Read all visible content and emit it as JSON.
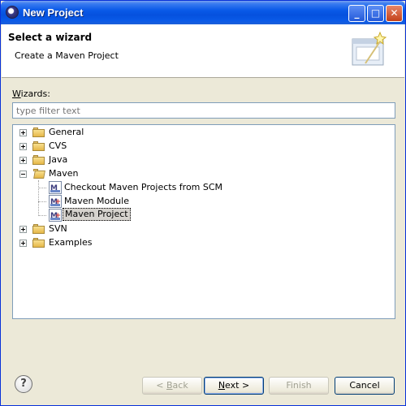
{
  "window": {
    "title": "New Project"
  },
  "header": {
    "title": "Select a wizard",
    "subtitle": "Create a Maven Project"
  },
  "wizards_label": {
    "accel": "W",
    "rest": "izards:"
  },
  "filter": {
    "placeholder": "type filter text",
    "value": ""
  },
  "tree": {
    "items": [
      {
        "label": "General",
        "expanded": false
      },
      {
        "label": "CVS",
        "expanded": false
      },
      {
        "label": "Java",
        "expanded": false
      },
      {
        "label": "Maven",
        "expanded": true,
        "children": [
          {
            "label": "Checkout Maven Projects from SCM"
          },
          {
            "label": "Maven Module"
          },
          {
            "label": "Maven Project",
            "selected": true
          }
        ]
      },
      {
        "label": "SVN",
        "expanded": false
      },
      {
        "label": "Examples",
        "expanded": false
      }
    ]
  },
  "buttons": {
    "back": {
      "accel": "B",
      "prefix": "< ",
      "rest": "ack",
      "enabled": false
    },
    "next": {
      "accel": "N",
      "rest": "ext >",
      "enabled": true
    },
    "finish": {
      "label": "Finish",
      "enabled": false
    },
    "cancel": {
      "label": "Cancel",
      "enabled": true
    }
  },
  "help": {
    "glyph": "?"
  },
  "icons": [
    "eclipse-icon",
    "minimize-icon",
    "maximize-icon",
    "close-icon",
    "wizard-banner-icon",
    "folder-icon",
    "maven-icon",
    "help-icon"
  ]
}
